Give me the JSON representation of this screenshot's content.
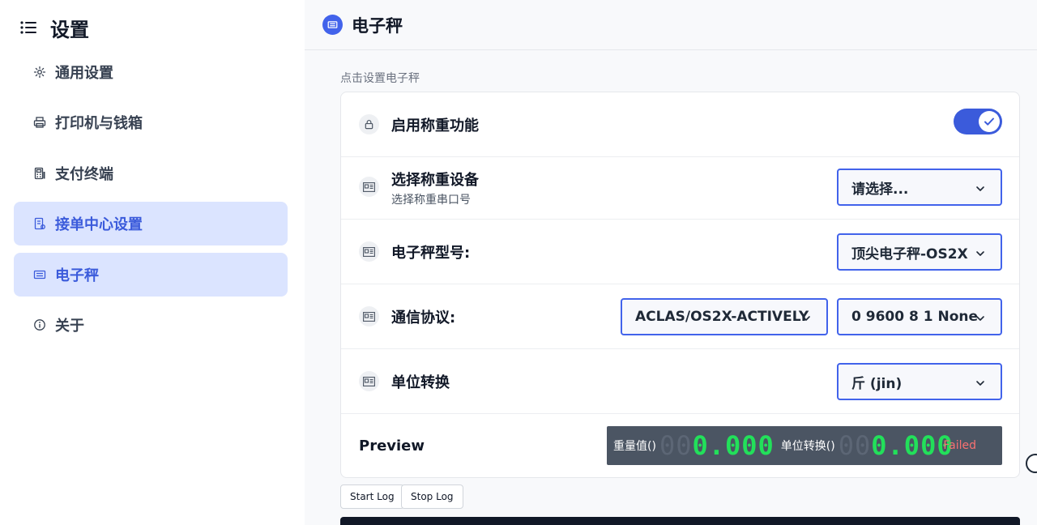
{
  "sidebar": {
    "title": "设置",
    "items": [
      {
        "label": "通用设置",
        "icon": "gear-icon",
        "active": false
      },
      {
        "label": "打印机与钱箱",
        "icon": "printer-icon",
        "active": false
      },
      {
        "label": "支付终端",
        "icon": "calculator-icon",
        "active": false
      },
      {
        "label": "接单中心设置",
        "icon": "order-icon",
        "active": true
      },
      {
        "label": "电子秤",
        "icon": "scale-icon",
        "active": true
      },
      {
        "label": "关于",
        "icon": "info-icon",
        "active": false
      }
    ]
  },
  "header": {
    "title": "电子秤"
  },
  "main": {
    "hint": "点击设置电子秤",
    "enable_label": "启用称重功能",
    "enable_on": true,
    "device_label": "选择称重设备",
    "device_sub": "选择称重串口号",
    "device_select": "请选择...",
    "model_label": "电子秤型号:",
    "model_select": "顶尖电子秤-OS2X",
    "protocol_label": "通信协议:",
    "protocol_select": "ACLAS/OS2X-ACTIVELY",
    "serial_select": "0 9600 8 1 None",
    "unit_label": "单位转换",
    "unit_select": "斤 (jin)",
    "preview_label": "Preview",
    "weight_label": "重量值()",
    "weight_ghost": "00",
    "weight_value": "0.000",
    "unit_conv_label": "单位转换()",
    "unit_conv_ghost": "00",
    "unit_conv_value": "0.000",
    "status": "Failed",
    "start_log": "Start Log",
    "stop_log": "Stop Log"
  },
  "colors": {
    "accent": "#3b5bdb",
    "active_bg": "#dbe4ff",
    "digit_green": "#22e05a",
    "failed_red": "#f87171",
    "display_bg": "#4b5563"
  }
}
